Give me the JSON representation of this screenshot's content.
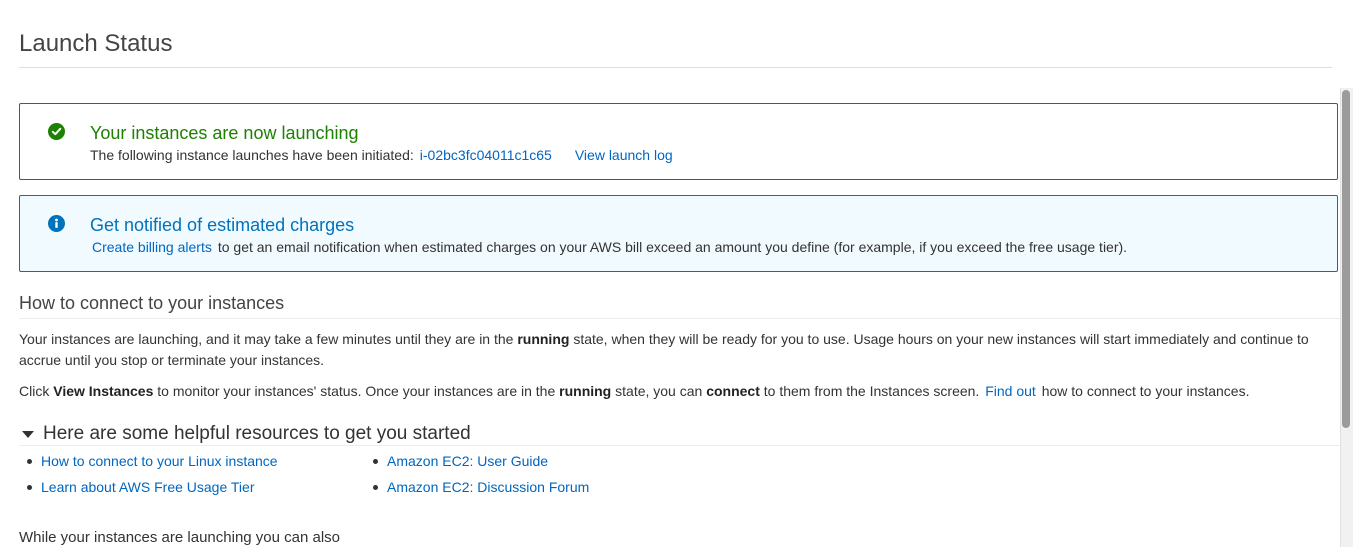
{
  "page": {
    "title": "Launch Status"
  },
  "success_alert": {
    "heading": "Your instances are now launching",
    "body_text": "The following instance launches have been initiated:",
    "instance_id": "i-02bc3fc04011c1c65",
    "view_log_label": "View launch log"
  },
  "info_alert": {
    "heading": "Get notified of estimated charges",
    "link_label": "Create billing alerts",
    "body_text": "to get an email notification when estimated charges on your AWS bill exceed an amount you define (for example, if you exceed the free usage tier)."
  },
  "connect": {
    "heading": "How to connect to your instances",
    "p1_a": "Your instances are launching, and it may take a few minutes until they are in the ",
    "p1_bold": "running",
    "p1_b": " state, when they will be ready for you to use. Usage hours on your new instances will start immediately and continue to accrue until you stop or terminate your instances.",
    "p2_a": "Click ",
    "p2_bold1": "View Instances",
    "p2_b": " to monitor your instances' status. Once your instances are in the ",
    "p2_bold2": "running",
    "p2_c": " state, you can ",
    "p2_bold3": "connect",
    "p2_d": " to them from the Instances screen. ",
    "p2_link": "Find out",
    "p2_e": " how to connect to your instances."
  },
  "resources": {
    "heading": "Here are some helpful resources to get you started",
    "col1": [
      "How to connect to your Linux instance",
      "Learn about AWS Free Usage Tier"
    ],
    "col2": [
      "Amazon EC2: User Guide",
      "Amazon EC2: Discussion Forum"
    ]
  },
  "also": {
    "heading": "While your instances are launching you can also"
  },
  "colors": {
    "success": "#1d8102",
    "info": "#0073bb",
    "link": "#0066c0"
  },
  "icons": {
    "success": "check-circle-icon",
    "info": "info-circle-icon",
    "caret": "caret-down-icon"
  }
}
